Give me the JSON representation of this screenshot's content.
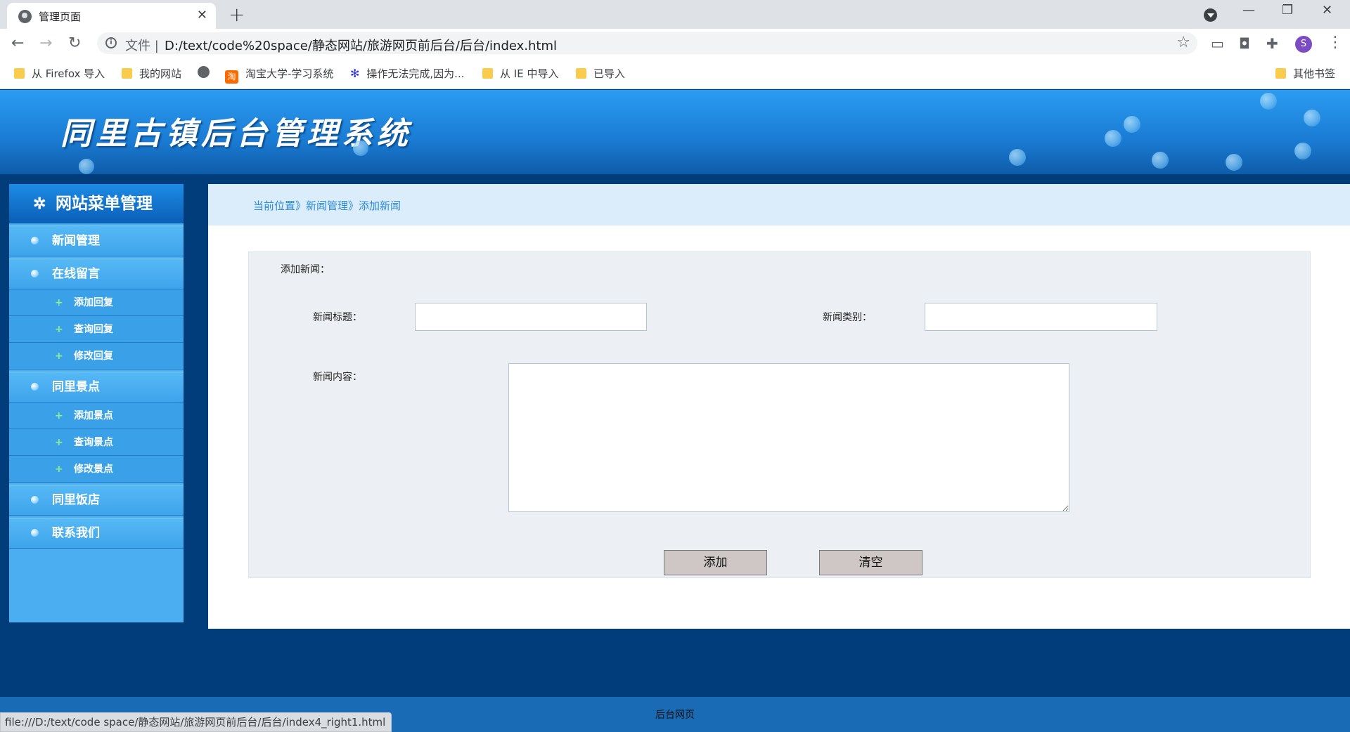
{
  "browser": {
    "tab_title": "管理页面",
    "tab_close": "✕",
    "new_tab": "+",
    "scheme_label": "文件",
    "url": "D:/text/code%20space/静态网站/旅游网页前后台/后台/index.html",
    "profile_initial": "S",
    "status_url": "file:///D:/text/code space/静态网站/旅游网页前后台/后台/index4_right1.html",
    "bookmarks": [
      {
        "label": "从 Firefox 导入",
        "icon": "folder"
      },
      {
        "label": "我的网站",
        "icon": "folder"
      },
      {
        "label": "",
        "icon": "globe"
      },
      {
        "label": "淘宝大学-学习系统",
        "icon": "taobao"
      },
      {
        "label": "操作无法完成,因为...",
        "icon": "baidu-paw"
      },
      {
        "label": "从 IE 中导入",
        "icon": "folder"
      },
      {
        "label": "已导入",
        "icon": "folder"
      }
    ],
    "other_bookmarks": "其他书签",
    "taobao_glyph": "淘",
    "icons": {
      "back": "←",
      "forward": "→",
      "reload": "↻",
      "star": "☆",
      "minimize": "—",
      "restore": "❐",
      "close": "✕",
      "menu": "⋮",
      "info": "i",
      "puzzle": "✚",
      "camera": "◘",
      "cast": "▭",
      "paw": "✻"
    }
  },
  "banner": {
    "title": "同里古镇后台管理系统"
  },
  "sidebar": {
    "header": "网站菜单管理",
    "gear": "✲",
    "plus": "+",
    "items": [
      {
        "label": "新闻管理",
        "type": "item"
      },
      {
        "label": "在线留言",
        "type": "item"
      },
      {
        "label": "添加回复",
        "type": "sub"
      },
      {
        "label": "查询回复",
        "type": "sub"
      },
      {
        "label": "修改回复",
        "type": "sub"
      },
      {
        "label": "同里景点",
        "type": "item"
      },
      {
        "label": "添加景点",
        "type": "sub"
      },
      {
        "label": "查询景点",
        "type": "sub"
      },
      {
        "label": "修改景点",
        "type": "sub"
      },
      {
        "label": "同里饭店",
        "type": "item"
      },
      {
        "label": "联系我们",
        "type": "item"
      }
    ]
  },
  "breadcrumb": {
    "text": "当前位置》新闻管理》添加新闻"
  },
  "form": {
    "heading": "添加新闻：",
    "title_label": "新闻标题：",
    "title_value": "",
    "category_label": "新闻类别：",
    "category_value": "",
    "content_label": "新闻内容：",
    "content_value": "",
    "add_button": "添加",
    "clear_button": "清空"
  },
  "footer": {
    "text": "后台网页"
  },
  "colors": {
    "accent": "#2d8ad8",
    "page_bg": "#003d7a",
    "sidebar": "#4aaef0"
  }
}
